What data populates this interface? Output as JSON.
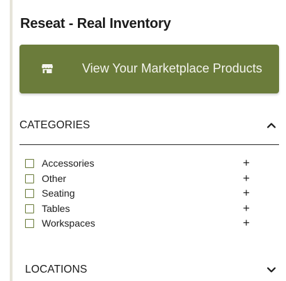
{
  "header": {
    "title": "Reseat - Real Inventory"
  },
  "marketplace_button": {
    "label": "View Your Marketplace Products",
    "icon": "store-icon"
  },
  "categories": {
    "label": "CATEGORIES",
    "expanded": true,
    "toggle_icon": "chevron-up-icon",
    "items": [
      {
        "label": "Accessories",
        "checked": false,
        "expand_symbol": "+"
      },
      {
        "label": "Other",
        "checked": false,
        "expand_symbol": "+"
      },
      {
        "label": "Seating",
        "checked": false,
        "expand_symbol": "+"
      },
      {
        "label": "Tables",
        "checked": false,
        "expand_symbol": "+"
      },
      {
        "label": "Workspaces",
        "checked": false,
        "expand_symbol": "+"
      }
    ]
  },
  "locations": {
    "label": "LOCATIONS",
    "expanded": false,
    "toggle_icon": "chevron-down-icon"
  },
  "colors": {
    "accent": "#6b7c3b",
    "button_text": "#f4f4ee",
    "text": "#1b1b1b"
  }
}
